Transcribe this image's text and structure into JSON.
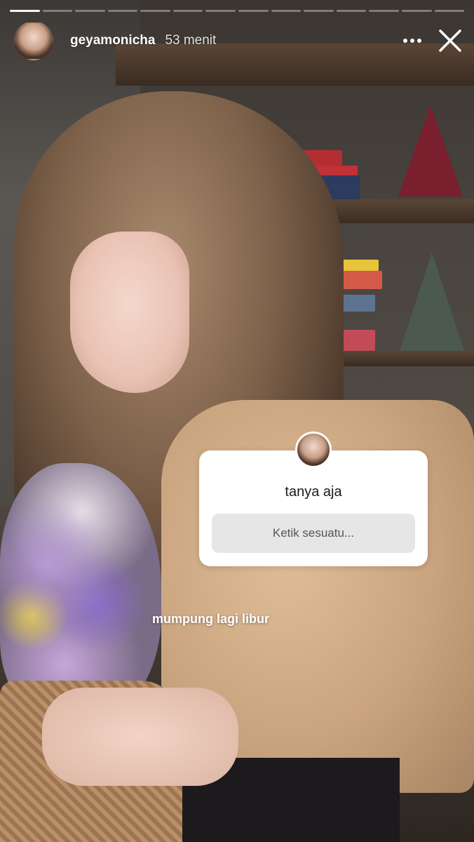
{
  "story": {
    "progress_segments": 14,
    "active_segment": 1
  },
  "header": {
    "username": "geyamonicha",
    "time": "53 menit",
    "more_icon": "more-horizontal-icon",
    "close_icon": "close-icon"
  },
  "question_sticker": {
    "title": "tanya aja",
    "placeholder": "Ketik sesuatu..."
  },
  "caption": "mumpung lagi libur"
}
